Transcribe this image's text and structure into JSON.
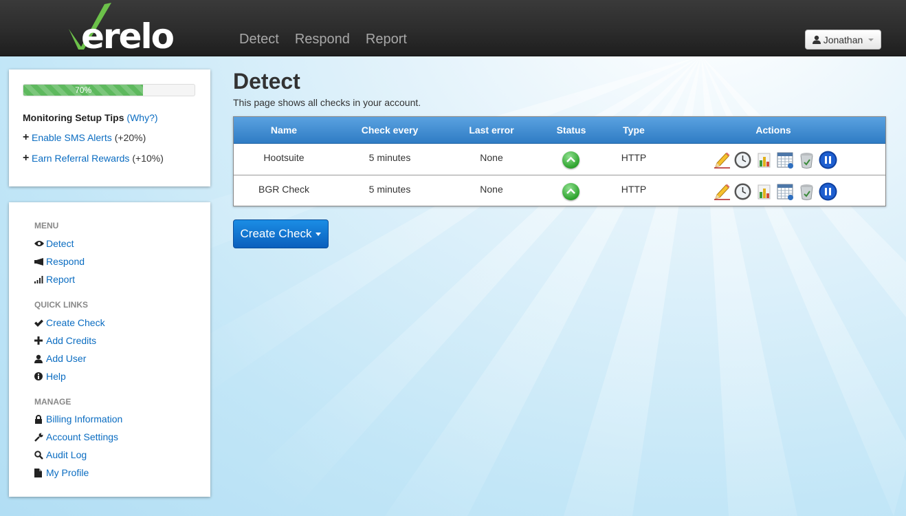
{
  "brand": {
    "name": "erelo",
    "accent_color": "#6cc14a"
  },
  "nav": {
    "items": [
      "Detect",
      "Respond",
      "Report"
    ]
  },
  "user_menu": {
    "label": "Jonathan",
    "icon": "user-icon"
  },
  "setup_tips": {
    "progress_percent": 70,
    "progress_label": "70%",
    "title": "Monitoring Setup Tips",
    "why_link": "(Why?)",
    "tips": [
      {
        "label": "Enable SMS Alerts",
        "bonus": "(+20%)"
      },
      {
        "label": "Earn Referral Rewards",
        "bonus": "(+10%)"
      }
    ]
  },
  "sidebar": {
    "menu_heading": "MENU",
    "menu": [
      {
        "label": "Detect",
        "icon": "eye-icon"
      },
      {
        "label": "Respond",
        "icon": "megaphone-icon"
      },
      {
        "label": "Report",
        "icon": "signal-bars-icon"
      }
    ],
    "quick_heading": "QUICK LINKS",
    "quick_links": [
      {
        "label": "Create Check",
        "icon": "checkmark-icon"
      },
      {
        "label": "Add Credits",
        "icon": "plus-icon"
      },
      {
        "label": "Add User",
        "icon": "user-icon"
      },
      {
        "label": "Help",
        "icon": "info-icon"
      }
    ],
    "manage_heading": "MANAGE",
    "manage": [
      {
        "label": "Billing Information",
        "icon": "lock-icon"
      },
      {
        "label": "Account Settings",
        "icon": "wrench-icon"
      },
      {
        "label": "Audit Log",
        "icon": "search-icon"
      },
      {
        "label": "My Profile",
        "icon": "file-icon"
      }
    ]
  },
  "main": {
    "title": "Detect",
    "subtitle": "This page shows all checks in your account.",
    "table": {
      "columns": [
        "Name",
        "Check every",
        "Last error",
        "Status",
        "Type",
        "Actions"
      ],
      "rows": [
        {
          "name": "Hootsuite",
          "interval": "5 minutes",
          "last_error": "None",
          "status": "up",
          "type": "HTTP"
        },
        {
          "name": "BGR Check",
          "interval": "5 minutes",
          "last_error": "None",
          "status": "up",
          "type": "HTTP"
        }
      ],
      "action_icons": [
        "pencil-icon",
        "clock-icon",
        "bar-chart-icon",
        "calendar-icon",
        "trash-icon",
        "pause-icon"
      ],
      "header_color": "#3b8ad4"
    },
    "create_button": "Create Check"
  }
}
